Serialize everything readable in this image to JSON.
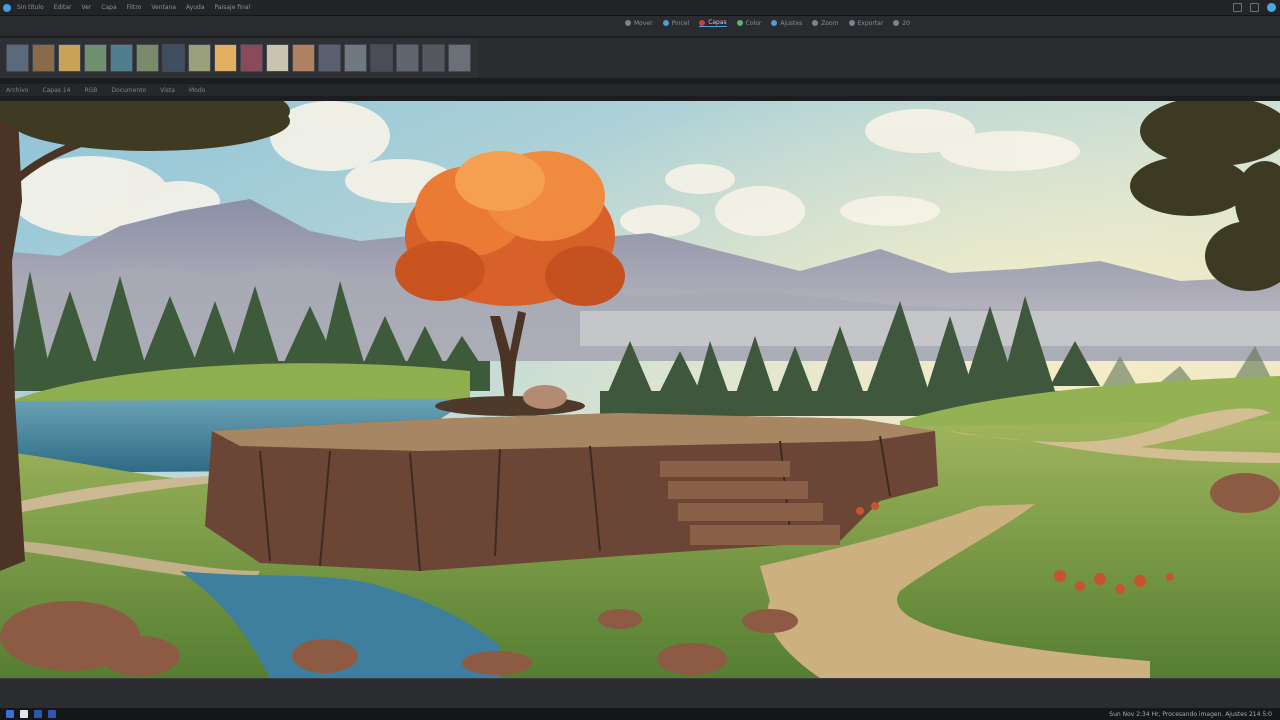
{
  "window": {
    "menu": [
      "Sin título",
      "Editar",
      "Ver",
      "Capa",
      "Filtro",
      "Ventana",
      "Ayuda"
    ],
    "title_snippet": "Paisaje final"
  },
  "toolbar": {
    "tools": [
      {
        "label": "Mover",
        "icon": "move-icon"
      },
      {
        "label": "Pincel",
        "icon": "brush-icon"
      },
      {
        "label": "Capas",
        "icon": "layers-icon"
      },
      {
        "label": "Color",
        "icon": "color-icon"
      },
      {
        "label": "Ajustes",
        "icon": "adjust-icon"
      },
      {
        "label": "Zoom",
        "icon": "zoom-icon"
      },
      {
        "label": "Exportar",
        "icon": "export-icon"
      },
      {
        "label": "20",
        "icon": "size-icon"
      }
    ]
  },
  "statusrow": [
    "Archivo",
    "Capas 14",
    "RGB",
    "Documento",
    "Vista",
    "Modo"
  ],
  "taskbar": {
    "status": "Sun Nov 2:34 Hr, Procesando imagen. Ajustes 214 5:0"
  },
  "colors": {
    "sky_top": "#8ec3d8",
    "sky_horizon": "#f4dfae",
    "autumn_tree": "#e0692a",
    "grass": "#6f9a3e",
    "water": "#3f7f9a",
    "rock": "#6b4636"
  }
}
